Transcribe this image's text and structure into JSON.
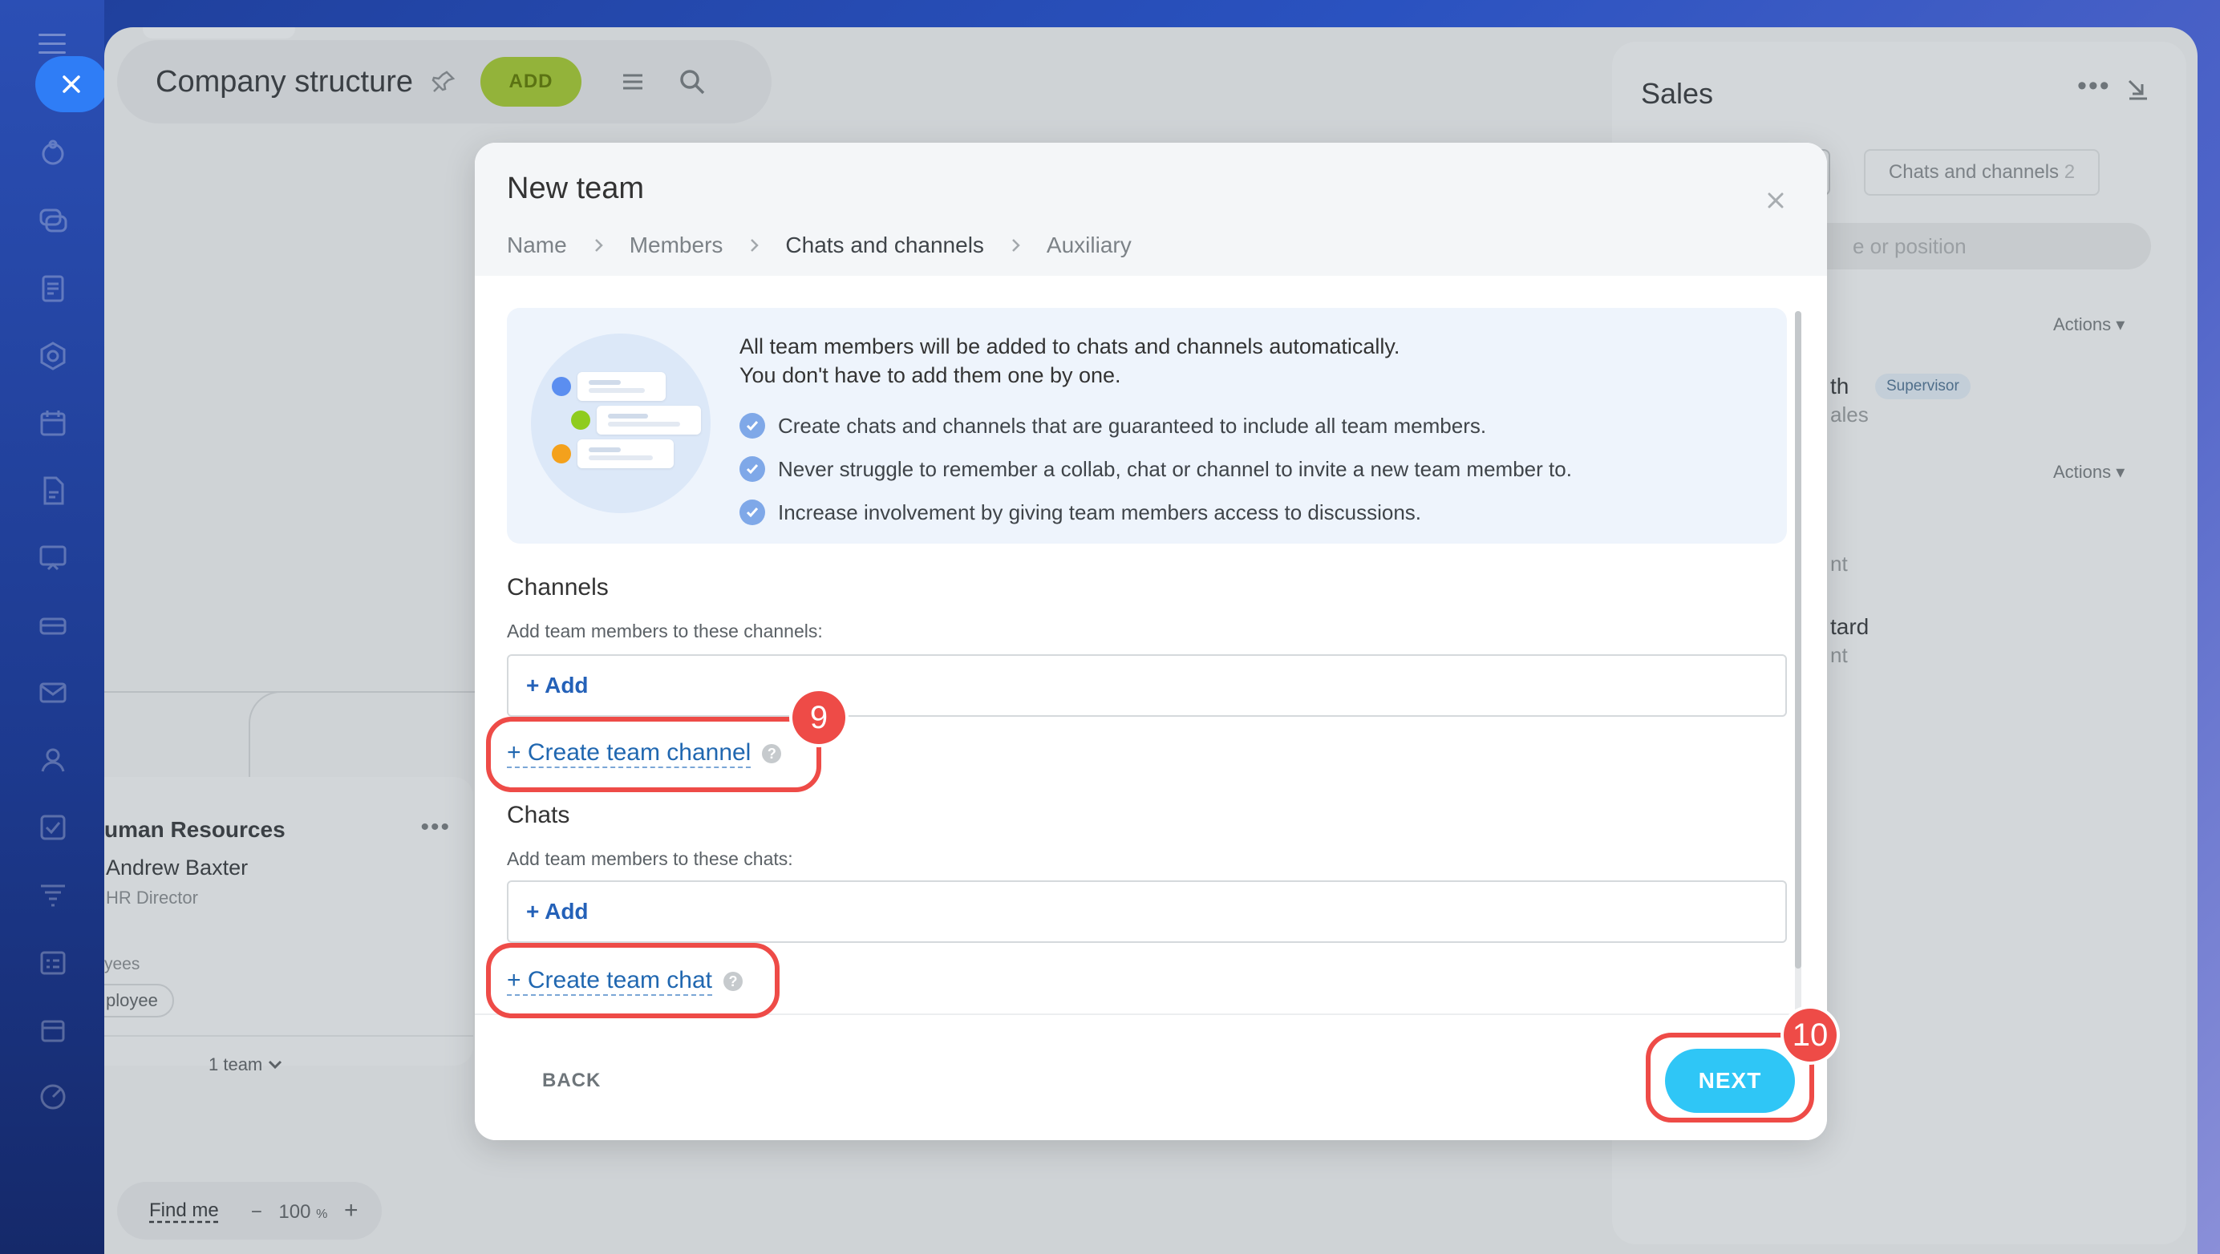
{
  "app": {
    "page_title": "Company structure",
    "add_label": "ADD"
  },
  "org": {
    "dept_name": "uman Resources",
    "head_name": "Andrew Baxter",
    "head_role": "HR Director",
    "employees_label": "yees",
    "employee_pill": "ployee",
    "team_toggle": "1 team"
  },
  "bottombar": {
    "find_me": "Find me",
    "zoom_minus": "−",
    "zoom_value": "100",
    "zoom_unit": "%",
    "zoom_plus": "+"
  },
  "sidepanel": {
    "title": "Sales",
    "tab_chats": "Chats and channels",
    "tab_chats_count": "2",
    "search_placeholder": "e or position",
    "actions_1": "Actions",
    "actions_2": "Actions",
    "row1_name": "th",
    "row1_badge": "Supervisor",
    "row1_sub": "ales",
    "row2_sub": "nt",
    "row3_name": "tard",
    "row3_sub": "nt"
  },
  "modal": {
    "title": "New team",
    "breadcrumbs": [
      "Name",
      "Members",
      "Chats and channels",
      "Auxiliary"
    ],
    "active_step": 2,
    "info_line1": "All team members will be added to chats and channels automatically.",
    "info_line2": "You don't have to add them one by one.",
    "bullets": [
      "Create chats and channels that are guaranteed to include all team members.",
      "Never struggle to remember a collab, chat or channel to invite a new team member to.",
      "Increase involvement by giving team members access to discussions."
    ],
    "channels_title": "Channels",
    "channels_sub": "Add team members to these channels:",
    "channels_add": "+ Add",
    "create_channel": "+ Create team channel",
    "chats_title": "Chats",
    "chats_sub": "Add team members to these chats:",
    "chats_add": "+ Add",
    "create_chat": "+ Create team chat",
    "help_glyph": "?",
    "back_label": "BACK",
    "next_label": "NEXT"
  },
  "callouts": {
    "step_9": "9",
    "step_10": "10"
  },
  "colors": {
    "accent_blue": "#2fc6f6",
    "callout_red": "#ee4b47",
    "add_green": "#93b33a"
  }
}
